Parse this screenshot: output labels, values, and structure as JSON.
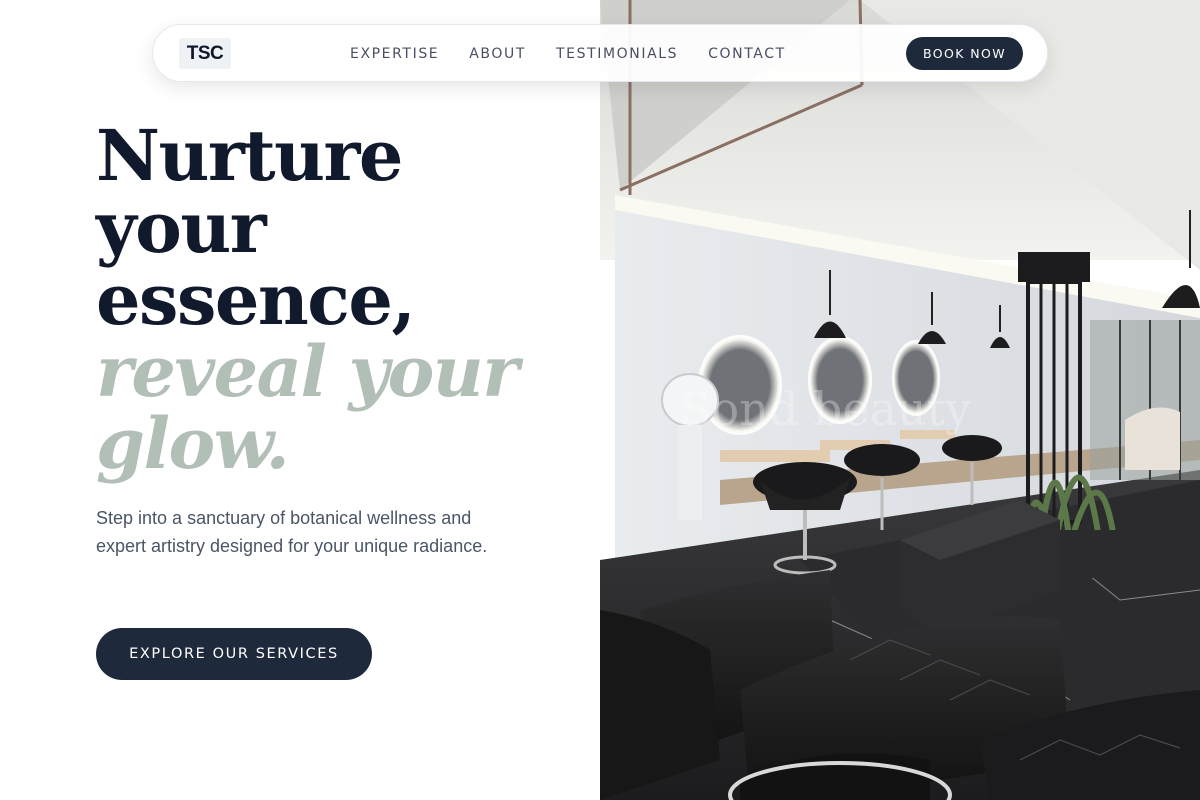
{
  "brand": {
    "logo_text": "TSC"
  },
  "nav": {
    "items": [
      {
        "label": "EXPERTISE"
      },
      {
        "label": "ABOUT"
      },
      {
        "label": "TESTIMONIALS"
      },
      {
        "label": "CONTACT"
      }
    ],
    "cta_label": "BOOK NOW"
  },
  "hero": {
    "headline_lines": [
      "Nurture",
      "your",
      "essence,"
    ],
    "accent_lines": [
      "reveal your",
      "glow."
    ],
    "subtitle": "Step into a sanctuary of botanical wellness and expert artistry designed for your unique radiance.",
    "cta_label": "EXPLORE OUR SERVICES",
    "image_watermark": "Sond beauty"
  },
  "colors": {
    "navy": "#1e293b",
    "headline": "#111a2c",
    "accent_sage": "#b1bfb6",
    "body_text": "#4a5567"
  }
}
